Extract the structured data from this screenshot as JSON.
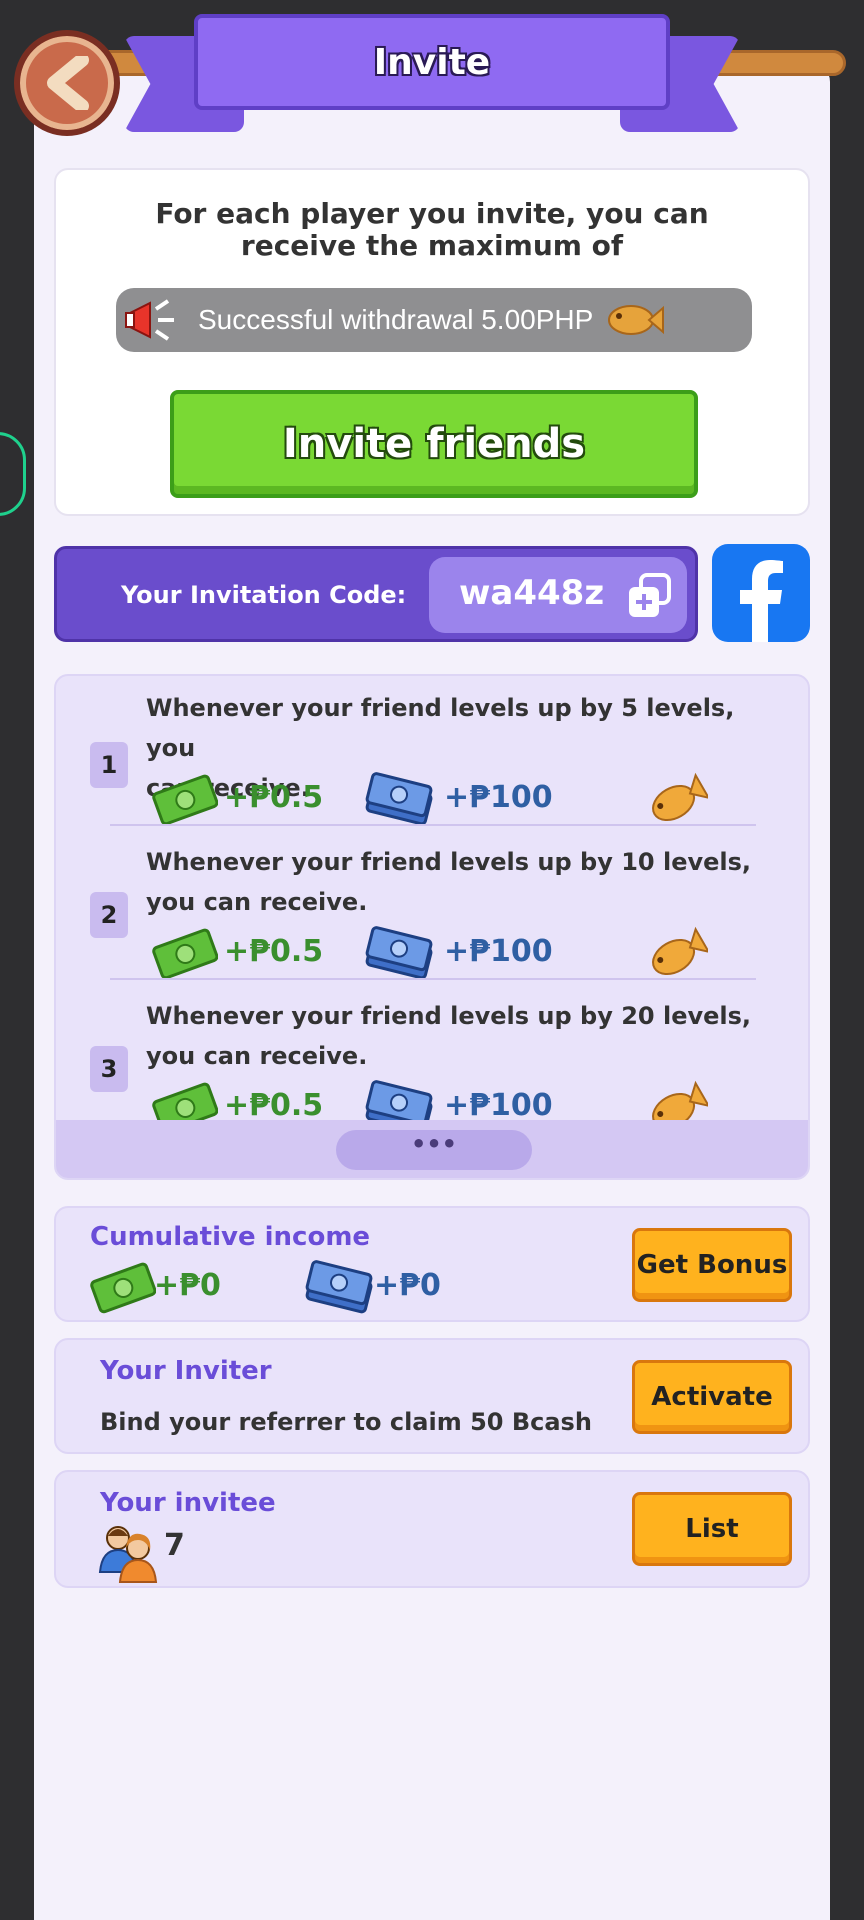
{
  "header": {
    "title": "Invite"
  },
  "intro": {
    "line1": "For each player you invite, you can",
    "line2": "receive the maximum of",
    "ticker": "Successful withdrawal 5.00PHP"
  },
  "invite_button": "Invite friends",
  "invitation": {
    "label": "Your Invitation Code:",
    "code": "wa448z"
  },
  "rewards": [
    {
      "index": "1",
      "line1": "Whenever your friend levels up by 5 levels, you",
      "line2": "can receive.",
      "green_amount": "+₱0.5",
      "blue_amount": "+₱100"
    },
    {
      "index": "2",
      "line1": "Whenever your friend levels up by 10 levels,",
      "line2": "you can receive.",
      "green_amount": "+₱0.5",
      "blue_amount": "+₱100"
    },
    {
      "index": "3",
      "line1": "Whenever your friend levels up by 20 levels,",
      "line2": "you can receive.",
      "green_amount": "+₱0.5",
      "blue_amount": "+₱100"
    }
  ],
  "more_label": "•••",
  "cumulative": {
    "title": "Cumulative income",
    "green_amount": "+₱0",
    "blue_amount": "+₱0",
    "button": "Get Bonus"
  },
  "inviter": {
    "title": "Your Inviter",
    "text": "Bind your referrer to claim 50 Bcash",
    "button": "Activate"
  },
  "invitee": {
    "title": "Your invitee",
    "count": "7",
    "button": "List"
  },
  "colors": {
    "panel": "#f4f1fb",
    "accent_purple": "#6a4dd8",
    "invite_green": "#7ad934",
    "action_orange": "#ffb21e",
    "facebook_blue": "#1877f2"
  },
  "icons": [
    "back-arrow-icon",
    "megaphone-icon",
    "copy-plus-icon",
    "facebook-icon",
    "green-cash-icon",
    "blue-cash-icon",
    "taiyaki-fish-icon",
    "people-icon"
  ]
}
